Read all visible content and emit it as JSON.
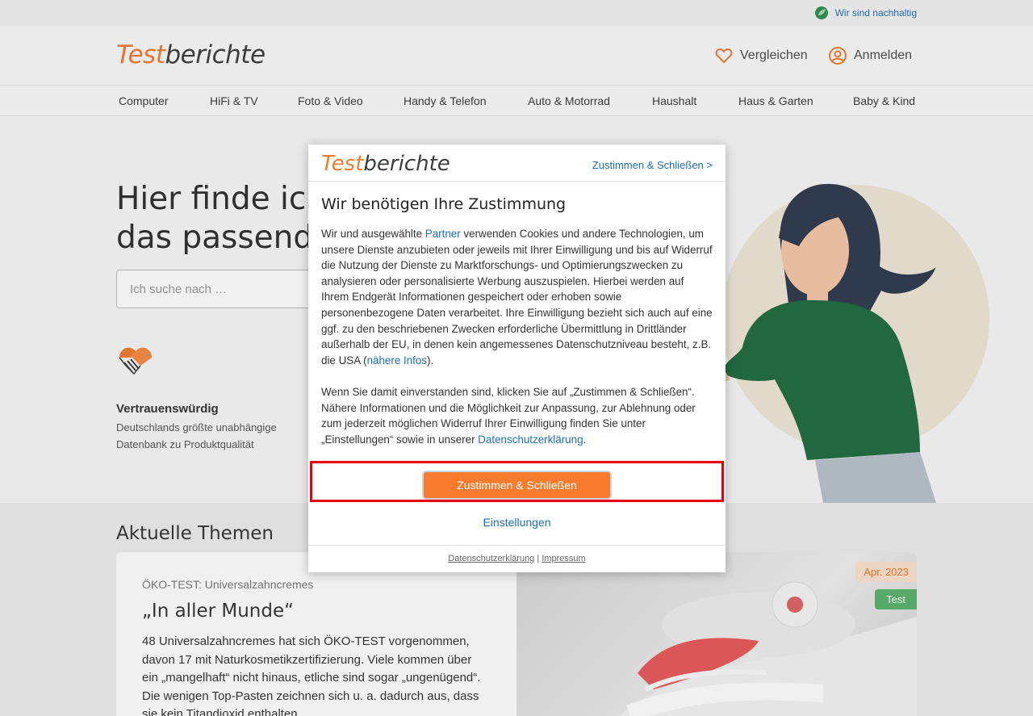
{
  "topbar": {
    "sustain_label": "Wir sind nachhaltig"
  },
  "header": {
    "logo_part1": "Test",
    "logo_part2": "berichte",
    "compare_label": "Vergleichen",
    "login_label": "Anmelden"
  },
  "nav": {
    "items": [
      {
        "label": "Computer"
      },
      {
        "label": "HiFi & TV"
      },
      {
        "label": "Foto & Video"
      },
      {
        "label": "Handy & Telefon"
      },
      {
        "label": "Auto & Motorrad"
      },
      {
        "label": "Haushalt"
      },
      {
        "label": "Haus & Garten"
      },
      {
        "label": "Baby & Kind"
      }
    ]
  },
  "hero": {
    "title_line1": "Hier finde ich",
    "title_line2": "das passende",
    "search_placeholder": "Ich suche nach …",
    "trust_title": "Vertrauenswürdig",
    "trust_desc": "Deutschlands größte unabhängige Datenbank zu Produktqualität"
  },
  "topics": {
    "heading": "Aktuelle Themen",
    "card": {
      "kicker": "ÖKO-TEST: Universalzahncremes",
      "title": "„In aller Munde“",
      "text": "48 Universalzahncremes hat sich ÖKO-TEST vorgenommen, davon 17 mit Naturkosmetikzertifizierung. Viele kommen über ein „mangelhaft“ nicht hinaus, etliche sind sogar „ungenügend“. Die wenigen Top-Pasten zeichnen sich u. a. dadurch aus, dass sie kein Titandioxid enthalten.",
      "date_badge": "Apr. 2023",
      "type_badge": "Test"
    }
  },
  "modal": {
    "logo_part1": "Test",
    "logo_part2": "berichte",
    "accept_link": "Zustimmen & Schließen >",
    "title": "Wir benötigen Ihre Zustimmung",
    "p1_a": "Wir und ausgewählte ",
    "p1_link_partner": "Partner",
    "p1_b": " verwenden Cookies und andere Technologien, um unsere Dienste anzubieten oder jeweils mit Ihrer Einwilligung und bis auf Widerruf die Nutzung der Dienste zu Marktforschungs- und Optimierungszwecken zu analysieren oder personalisierte Werbung auszuspielen. Hierbei werden auf Ihrem Endgerät Informationen gespeichert oder erhoben sowie personenbezogene Daten verarbeitet. Ihre Einwilligung bezieht sich auch auf eine ggf. zu den beschriebenen Zwecken erforderliche Übermittlung in Drittländer außerhalb der EU, in denen kein angemessenes Datenschutzniveau besteht, z.B. die USA (",
    "p1_link_info": "nähere Infos",
    "p1_c": ").",
    "p2_a": "Wenn Sie damit einverstanden sind, klicken Sie auf „Zustimmen & Schließen“. Nähere Informationen und die Möglichkeit zur Anpassung, zur Ablehnung oder zum jederzeit möglichen Widerruf Ihrer Einwilligung finden Sie unter „Einstellungen“ sowie in unserer ",
    "p2_link_privacy": "Datenschutzerklärung",
    "p2_b": ".",
    "accept_button": "Zustimmen & Schließen",
    "settings_link": "Einstellungen",
    "footer_privacy": "Datenschutzerklärung",
    "footer_sep": " | ",
    "footer_imprint": "Impressum"
  },
  "colors": {
    "brand_orange": "#f07b2f",
    "button_orange": "#f97b2d",
    "link_blue": "#1b6fb5",
    "highlight_red": "#e8000b",
    "badge_green": "#58b26c"
  }
}
